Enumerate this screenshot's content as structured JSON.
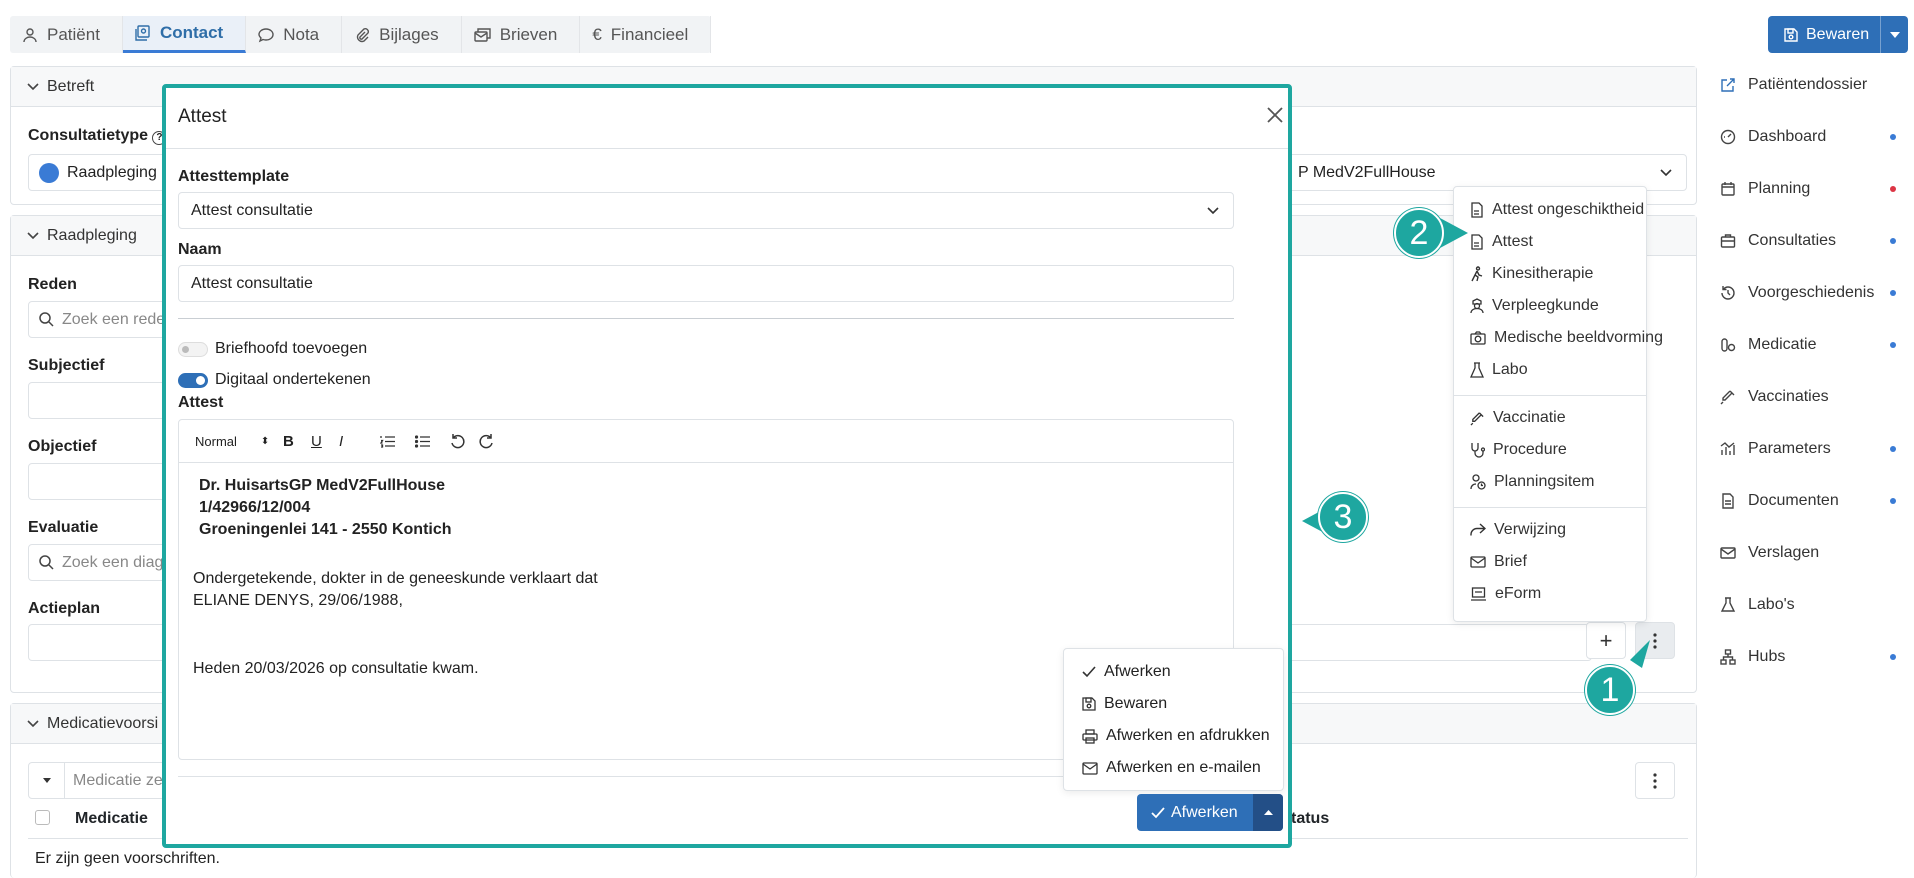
{
  "tabs": [
    {
      "label": "Patiënt",
      "icon": "person-icon"
    },
    {
      "label": "Contact",
      "icon": "contact-icon"
    },
    {
      "label": "Nota",
      "icon": "chat-icon"
    },
    {
      "label": "Bijlages",
      "icon": "paperclip-icon"
    },
    {
      "label": "Brieven",
      "icon": "letters-icon"
    },
    {
      "label": "Financieel",
      "icon": "euro-icon"
    }
  ],
  "active_tab": "Contact",
  "save_button": "Bewaren",
  "sections": {
    "betreft": "Betreft",
    "consultatietype_label": "Consultatietype",
    "consultatietype_value": "Raadpleging",
    "doctor_value": "P MedV2FullHouse",
    "raadpleging": "Raadpleging",
    "reden_label": "Reden",
    "reden_placeholder": "Zoek een rede",
    "subjectief_label": "Subjectief",
    "objectief_label": "Objectief",
    "evaluatie_label": "Evaluatie",
    "evaluatie_placeholder": "Zoek een diag",
    "actieplan_label": "Actieplan",
    "medicatievoorschriften": "Medicatievoorsi",
    "medicatie_placeholder": "Medicatie ze",
    "medicatie_col": "Medicatie",
    "status_col": "tatus",
    "no_prescriptions": "Er zijn geen voorschriften."
  },
  "sidebar": {
    "items": [
      {
        "label": "Patiëntendossier",
        "icon": "external-link-icon",
        "dot": null
      },
      {
        "label": "Dashboard",
        "icon": "dashboard-icon",
        "dot": "#3a7bd5"
      },
      {
        "label": "Planning",
        "icon": "calendar-icon",
        "dot": "#dc3545"
      },
      {
        "label": "Consultaties",
        "icon": "briefcase-icon",
        "dot": "#3a7bd5"
      },
      {
        "label": "Voorgeschiedenis",
        "icon": "history-icon",
        "dot": "#3a7bd5"
      },
      {
        "label": "Medicatie",
        "icon": "pills-icon",
        "dot": "#3a7bd5"
      },
      {
        "label": "Vaccinaties",
        "icon": "syringe-icon",
        "dot": null
      },
      {
        "label": "Parameters",
        "icon": "chart-icon",
        "dot": "#3a7bd5"
      },
      {
        "label": "Documenten",
        "icon": "document-icon",
        "dot": "#3a7bd5"
      },
      {
        "label": "Verslagen",
        "icon": "mail-icon",
        "dot": null
      },
      {
        "label": "Labo's",
        "icon": "flask-icon",
        "dot": null
      },
      {
        "label": "Hubs",
        "icon": "hubs-icon",
        "dot": "#3a7bd5"
      }
    ]
  },
  "add_menu": {
    "group1": [
      {
        "label": "Attest ongeschiktheid",
        "icon": "document-icon"
      },
      {
        "label": "Attest",
        "icon": "document-icon"
      },
      {
        "label": "Kinesitherapie",
        "icon": "walking-icon"
      },
      {
        "label": "Verpleegkunde",
        "icon": "nurse-icon"
      },
      {
        "label": "Medische beeldvorming",
        "icon": "camera-icon"
      },
      {
        "label": "Labo",
        "icon": "flask-icon"
      }
    ],
    "group2": [
      {
        "label": "Vaccinatie",
        "icon": "syringe-icon"
      },
      {
        "label": "Procedure",
        "icon": "stethoscope-icon"
      },
      {
        "label": "Planningsitem",
        "icon": "person-clock-icon"
      }
    ],
    "group3": [
      {
        "label": "Verwijzing",
        "icon": "share-icon"
      },
      {
        "label": "Brief",
        "icon": "mail-icon"
      },
      {
        "label": "eForm",
        "icon": "laptop-icon"
      }
    ]
  },
  "modal": {
    "title": "Attest",
    "template_label": "Attesttemplate",
    "template_value": "Attest consultatie",
    "naam_label": "Naam",
    "naam_value": "Attest consultatie",
    "briefhoofd_label": "Briefhoofd toevoegen",
    "briefhoofd_on": false,
    "digitaal_label": "Digitaal ondertekenen",
    "digitaal_on": true,
    "attest_label": "Attest",
    "toolbar": {
      "heading": "Normal",
      "bold": "B",
      "underline": "U",
      "italic": "I"
    },
    "editor_lines": {
      "l1": "Dr. HuisartsGP MedV2FullHouse",
      "l2": "1/42966/12/004",
      "l3": "Groeningenlei 141 - 2550 Kontich",
      "l4": "Ondergetekende, dokter in de geneeskunde verklaart dat",
      "l5": "ELIANE DENYS, 29/06/1988,",
      "l6": "Heden 20/03/2026 op consultatie kwam."
    },
    "finish_menu": [
      {
        "label": "Afwerken",
        "icon": "check-icon"
      },
      {
        "label": "Bewaren",
        "icon": "save-icon"
      },
      {
        "label": "Afwerken en afdrukken",
        "icon": "printer-icon"
      },
      {
        "label": "Afwerken en e-mailen",
        "icon": "mail-icon"
      }
    ],
    "finish_button": "Afwerken"
  },
  "callouts": [
    "1",
    "2",
    "3"
  ],
  "colors": {
    "accent": "#2e6fb7",
    "teal": "#1ea7a0",
    "dot_blue": "#3a7bd5",
    "dot_red": "#dc3545"
  }
}
